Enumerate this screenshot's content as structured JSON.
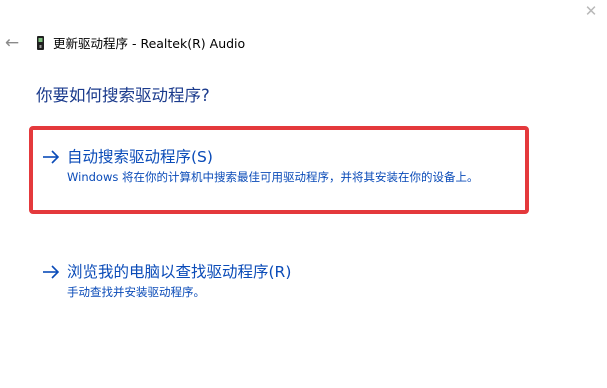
{
  "window": {
    "close_label": "✕",
    "back_label": "←",
    "device_icon": "device-icon",
    "title": "更新驱动程序 - Realtek(R) Audio"
  },
  "main": {
    "heading": "你要如何搜索驱动程序?",
    "options": [
      {
        "icon": "arrow-right-icon",
        "title": "自动搜索驱动程序(S)",
        "description": "Windows 将在你的计算机中搜索最佳可用驱动程序，并将其安装在你的设备上。",
        "highlighted": true
      },
      {
        "icon": "arrow-right-icon",
        "title": "浏览我的电脑以查找驱动程序(R)",
        "description": "手动查找并安装驱动程序。",
        "highlighted": false
      }
    ]
  },
  "colors": {
    "heading": "#1a3a8c",
    "link": "#0a4bb8",
    "highlight": "#e4393c"
  }
}
